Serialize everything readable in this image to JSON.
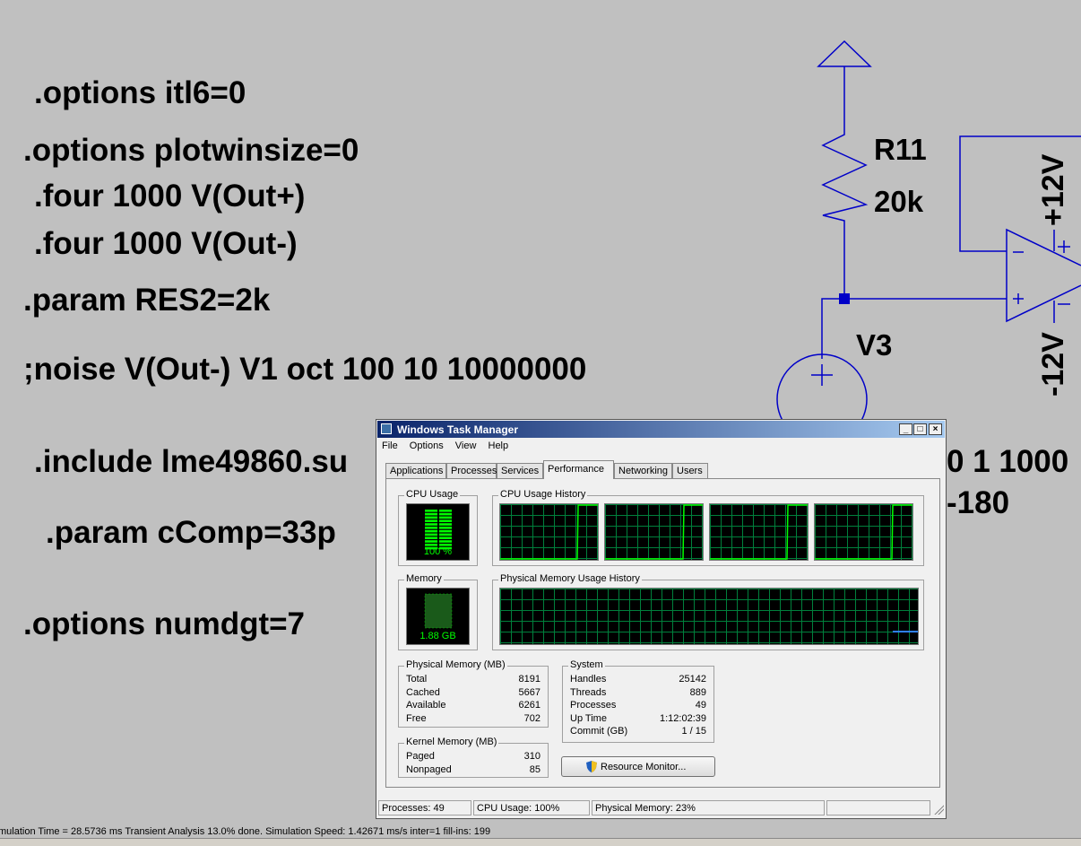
{
  "schematic": {
    "directives": [
      {
        "id": "d1",
        "text": ".options itl6=0"
      },
      {
        "id": "d2",
        "text": ".options plotwinsize=0"
      },
      {
        "id": "d3",
        "text": ".four 1000 V(Out+)"
      },
      {
        "id": "d4",
        "text": ".four 1000 V(Out-)"
      },
      {
        "id": "d5",
        "text": ".param RES2=2k"
      },
      {
        "id": "d6",
        "text": ";noise V(Out-) V1 oct 100 10 10000000"
      },
      {
        "id": "d7",
        "text": ".include lme49860.su"
      },
      {
        "id": "d8",
        "text": ".param cComp=33p"
      },
      {
        "id": "d9",
        "text": ".options numdgt=7"
      },
      {
        "id": "d10",
        "text": "0 1 1000"
      },
      {
        "id": "d11",
        "text": "-180"
      }
    ],
    "labels": {
      "r11_name": "R11",
      "r11_value": "20k",
      "v3_name": "V3",
      "supply_pos": "+12V",
      "supply_neg": "-12V"
    },
    "colors": {
      "wire": "#0000c8",
      "background": "#c0c0c0",
      "text": "#000000"
    }
  },
  "task_manager": {
    "title": "Windows Task Manager",
    "window_buttons": [
      "minimize-icon",
      "maximize-icon",
      "close-icon"
    ],
    "menu": [
      "File",
      "Options",
      "View",
      "Help"
    ],
    "tabs": [
      "Applications",
      "Processes",
      "Services",
      "Performance",
      "Networking",
      "Users"
    ],
    "active_tab": "Performance",
    "cpu_usage": {
      "label": "CPU Usage",
      "value": "100 %",
      "percent": 100
    },
    "cpu_history": {
      "label": "CPU Usage History"
    },
    "memory": {
      "label": "Memory",
      "value": "1.88 GB"
    },
    "memory_history": {
      "label": "Physical Memory Usage History"
    },
    "physical_memory": {
      "label": "Physical Memory (MB)",
      "rows": [
        {
          "key": "Total",
          "value": "8191"
        },
        {
          "key": "Cached",
          "value": "5667"
        },
        {
          "key": "Available",
          "value": "6261"
        },
        {
          "key": "Free",
          "value": "702"
        }
      ]
    },
    "kernel_memory": {
      "label": "Kernel Memory (MB)",
      "rows": [
        {
          "key": "Paged",
          "value": "310"
        },
        {
          "key": "Nonpaged",
          "value": "85"
        }
      ]
    },
    "system": {
      "label": "System",
      "rows": [
        {
          "key": "Handles",
          "value": "25142"
        },
        {
          "key": "Threads",
          "value": "889"
        },
        {
          "key": "Processes",
          "value": "49"
        },
        {
          "key": "Up Time",
          "value": "1:12:02:39"
        },
        {
          "key": "Commit (GB)",
          "value": "1 / 15"
        }
      ]
    },
    "resource_monitor_button": "Resource Monitor...",
    "status": {
      "processes": "Processes: 49",
      "cpu": "CPU Usage: 100%",
      "memory": "Physical Memory: 23%"
    },
    "colors": {
      "graph_green": "#00ff00",
      "graph_grid": "#00803c",
      "memory_line": "#2f7fff",
      "title_start": "#0a246a",
      "title_end": "#a6caf0"
    }
  },
  "app_status_bar": "mulation Time = 28.5736 ms  Transient Analysis 13.0% done. Simulation Speed: 1.42671 ms/s inter=1 fill-ins: 199"
}
